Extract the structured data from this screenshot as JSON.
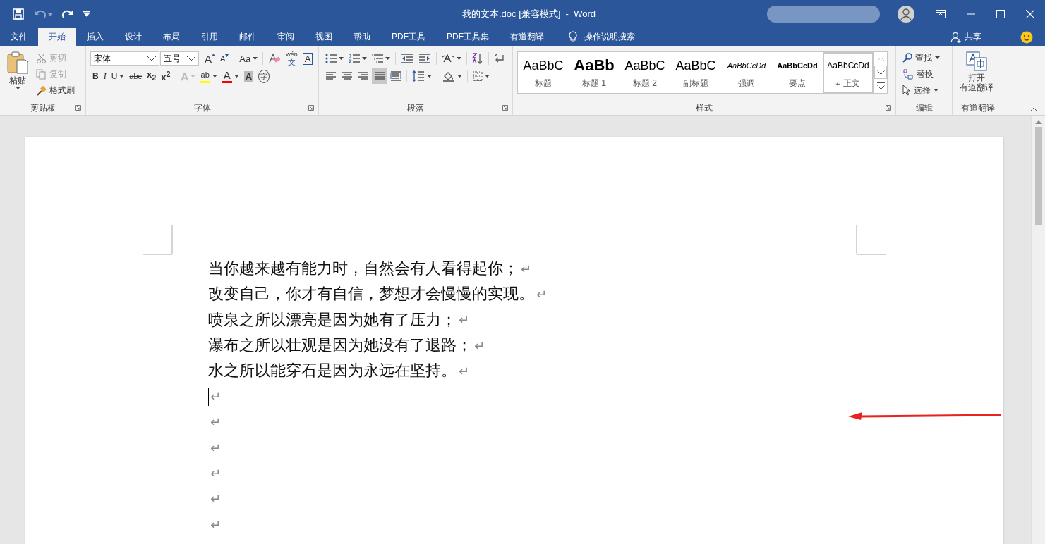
{
  "title_bar": {
    "title": "我的文本.doc [兼容模式]  -  Word"
  },
  "tabs": [
    {
      "label": "文件",
      "selected": false
    },
    {
      "label": "开始",
      "selected": true
    },
    {
      "label": "插入",
      "selected": false
    },
    {
      "label": "设计",
      "selected": false
    },
    {
      "label": "布局",
      "selected": false
    },
    {
      "label": "引用",
      "selected": false
    },
    {
      "label": "邮件",
      "selected": false
    },
    {
      "label": "审阅",
      "selected": false
    },
    {
      "label": "视图",
      "selected": false
    },
    {
      "label": "帮助",
      "selected": false
    },
    {
      "label": "PDF工具",
      "selected": false
    },
    {
      "label": "PDF工具集",
      "selected": false
    },
    {
      "label": "有道翻译",
      "selected": false
    }
  ],
  "tell_me": {
    "label": "操作说明搜索"
  },
  "share": {
    "label": "共享"
  },
  "ribbon": {
    "clipboard": {
      "paste": "粘贴",
      "items": [
        {
          "label": "剪切",
          "kind": "cut",
          "disabled": true
        },
        {
          "label": "复制",
          "kind": "copy",
          "disabled": true
        },
        {
          "label": "格式刷",
          "kind": "painter",
          "disabled": false
        }
      ],
      "group_label": "剪贴板"
    },
    "font": {
      "font_name": "宋体",
      "font_size": "五号",
      "group_label": "字体",
      "row_1": [
        {
          "kind": "grow",
          "glyph": "A"
        },
        {
          "kind": "shrink",
          "glyph": "A"
        },
        {
          "kind": "case",
          "glyph": "Aa",
          "dropdown": true
        },
        {
          "kind": "clear"
        },
        {
          "kind": "phonetic",
          "glyph": "wén",
          "sub": "文"
        },
        {
          "kind": "border",
          "glyph": "A"
        }
      ],
      "row_2": [
        {
          "kind": "bold",
          "glyph": "B"
        },
        {
          "kind": "italic",
          "glyph": "I"
        },
        {
          "kind": "underline",
          "glyph": "U",
          "dropdown": true
        },
        {
          "kind": "strike",
          "glyph": "abc"
        },
        {
          "kind": "script",
          "glyph": "x$_{2}$"
        },
        {
          "kind": "script",
          "glyph": "x$^{2}$"
        },
        {
          "kind": "effects",
          "glyph": "A",
          "disabled": true,
          "dropdown": true
        },
        {
          "kind": "highlight",
          "glyph": "ab",
          "color": "#ffff00",
          "dropdown": true
        },
        {
          "kind": "fontcolor",
          "glyph": "A",
          "color": "#ff0000",
          "dropdown": true
        },
        {
          "kind": "shading",
          "glyph": "A"
        },
        {
          "kind": "enclose",
          "glyph": "字"
        }
      ]
    },
    "paragraph": {
      "group_label": "段落",
      "row_1": [
        {
          "kind": "bullets",
          "dropdown": true
        },
        {
          "kind": "numbering",
          "dropdown": true
        },
        {
          "kind": "multilevel",
          "dropdown": true
        },
        {
          "kind": "outdent"
        },
        {
          "kind": "indent"
        },
        {
          "kind": "asian",
          "dropdown": true
        },
        {
          "kind": "sort"
        },
        {
          "kind": "marks"
        }
      ],
      "alignment": [
        {
          "kind": "left",
          "selected": false
        },
        {
          "kind": "center",
          "selected": false
        },
        {
          "kind": "right",
          "selected": false
        },
        {
          "kind": "justify",
          "selected": true
        },
        {
          "kind": "distributed",
          "selected": false
        }
      ],
      "row_2": [
        {
          "kind": "spacing",
          "dropdown": true
        },
        {
          "kind": "fill",
          "dropdown": true
        },
        {
          "kind": "borders",
          "dropdown": true
        }
      ]
    },
    "styles": {
      "group_label": "样式",
      "items": [
        {
          "preview": "AaBbC",
          "name": "标题",
          "kind": "title",
          "selected": false
        },
        {
          "preview": "AaBb",
          "name": "标题 1",
          "kind": "h1",
          "selected": false
        },
        {
          "preview": "AaBbC",
          "name": "标题 2",
          "kind": "h2",
          "selected": false
        },
        {
          "preview": "AaBbC",
          "name": "副标题",
          "kind": "subtitle",
          "selected": false
        },
        {
          "preview": "AaBbCcDd",
          "name": "强调",
          "kind": "emphasis",
          "selected": false
        },
        {
          "preview": "AaBbCcDd",
          "name": "要点",
          "kind": "strong",
          "selected": false
        },
        {
          "preview": "AaBbCcDd",
          "name": "正文",
          "kind": "normal",
          "selected": true,
          "mark": "↵"
        }
      ]
    },
    "editing": {
      "group_label": "编辑",
      "items": [
        {
          "label": "查找",
          "kind": "find",
          "dropdown": true
        },
        {
          "label": "替换",
          "kind": "replace",
          "dropdown": false
        },
        {
          "label": "选择",
          "kind": "select",
          "dropdown": true
        }
      ]
    },
    "translate": {
      "group_label": "有道翻译",
      "button": [
        "打开",
        "有道翻译"
      ]
    }
  },
  "document": {
    "lines": [
      {
        "text": "当你越来越有能力时，自然会有人看得起你；",
        "mark": "↵",
        "cursor": false
      },
      {
        "text": "改变自己，你才有自信，梦想才会慢慢的实现。",
        "mark": "↵",
        "cursor": false
      },
      {
        "text": "喷泉之所以漂亮是因为她有了压力；",
        "mark": "↵",
        "cursor": false
      },
      {
        "text": "瀑布之所以壮观是因为她没有了退路；",
        "mark": "↵",
        "cursor": false
      },
      {
        "text": "水之所以能穿石是因为永远在坚持。",
        "mark": "↵",
        "cursor": false
      },
      {
        "mark": "↵",
        "cursor": true
      },
      {
        "mark": "↵",
        "cursor": false
      },
      {
        "mark": "↵",
        "cursor": false
      },
      {
        "mark": "↵",
        "cursor": false
      },
      {
        "mark": "↵",
        "cursor": false
      },
      {
        "mark": "↵",
        "cursor": false
      }
    ]
  }
}
